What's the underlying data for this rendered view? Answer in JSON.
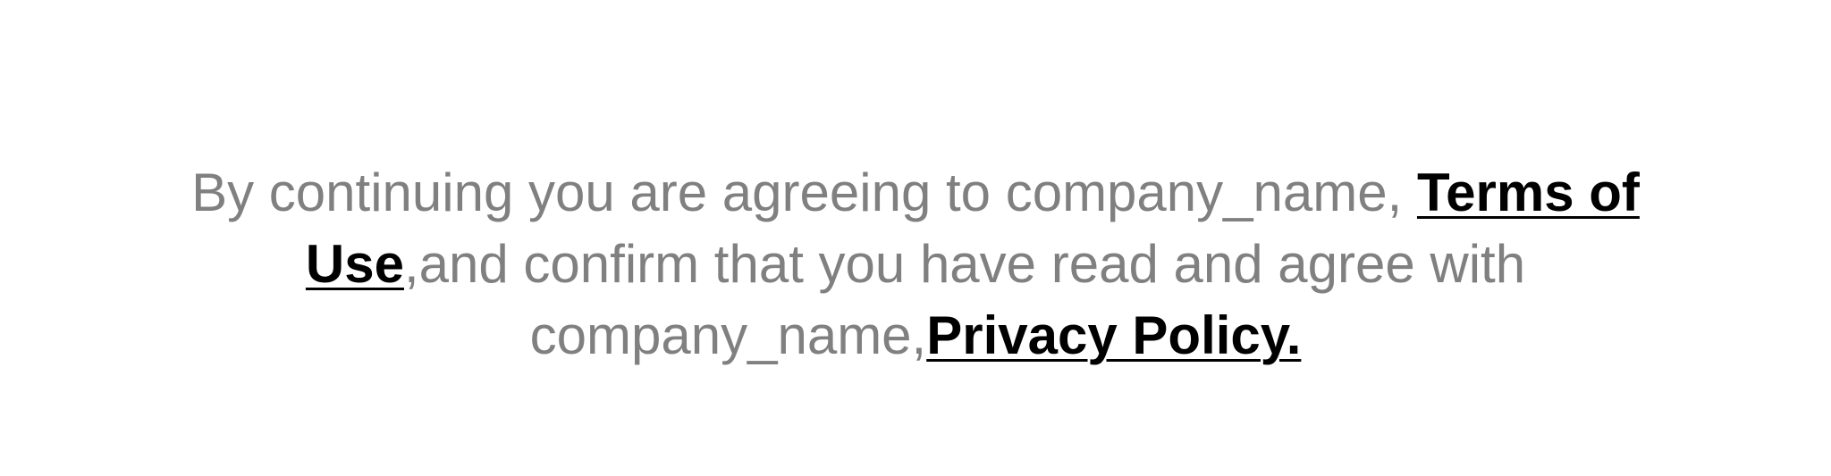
{
  "consent": {
    "text_before_terms": "By continuing you are agreeing to company_name, ",
    "terms_link": "Terms of Use",
    "text_between": ",and confirm that you have read and agree with company_name,",
    "privacy_link": "Privacy Policy."
  },
  "colors": {
    "body_text": "#808080",
    "link_text": "#000000",
    "background": "#ffffff"
  }
}
